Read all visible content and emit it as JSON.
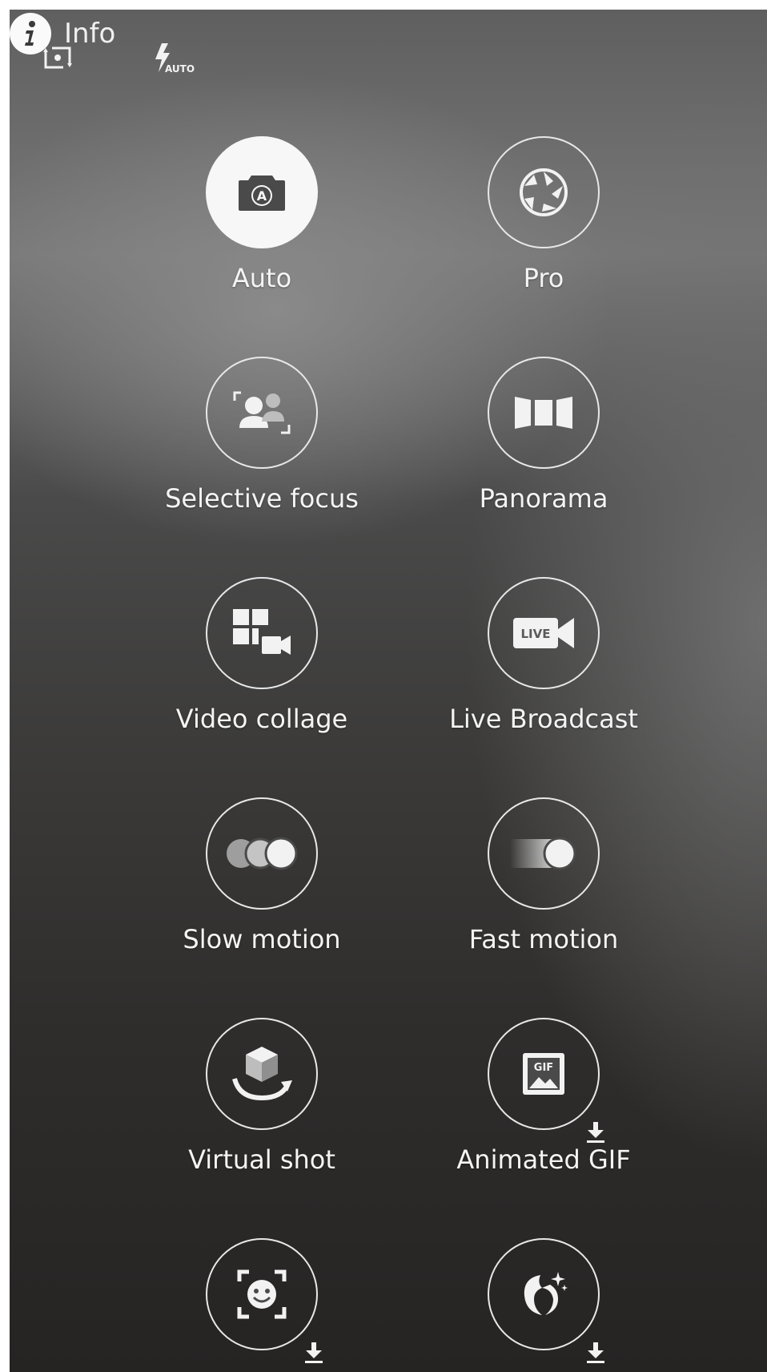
{
  "topbar": {
    "switch_camera_icon": "switch-camera-icon",
    "flash_icon": "flash-auto-icon",
    "flash_text": "AUTO",
    "info_icon": "info-icon",
    "info_label": "Info"
  },
  "modes": [
    {
      "label": "Auto",
      "icon": "camera-auto-icon",
      "selected": true
    },
    {
      "label": "Pro",
      "icon": "aperture-icon",
      "selected": false
    },
    {
      "label": "Selective focus",
      "icon": "selective-focus-icon",
      "selected": false
    },
    {
      "label": "Panorama",
      "icon": "panorama-icon",
      "selected": false
    },
    {
      "label": "Video collage",
      "icon": "video-collage-icon",
      "selected": false
    },
    {
      "label": "Live Broadcast",
      "icon": "live-broadcast-icon",
      "selected": false
    },
    {
      "label": "Slow motion",
      "icon": "slow-motion-icon",
      "selected": false
    },
    {
      "label": "Fast motion",
      "icon": "fast-motion-icon",
      "selected": false
    },
    {
      "label": "Virtual shot",
      "icon": "virtual-shot-icon",
      "selected": false
    },
    {
      "label": "Animated GIF",
      "icon": "animated-gif-icon",
      "selected": false,
      "downloadable": true,
      "gif_text": "GIF"
    },
    {
      "label": "",
      "icon": "face-sticker-icon",
      "selected": false,
      "downloadable": true
    },
    {
      "label": "",
      "icon": "beauty-face-icon",
      "selected": false,
      "downloadable": true
    }
  ],
  "live_text": "LIVE",
  "auto_badge": "A",
  "colors": {
    "icon": "#f2f2f2",
    "selected_bg": "#f7f7f7",
    "selected_icon": "#4a4a4a"
  }
}
